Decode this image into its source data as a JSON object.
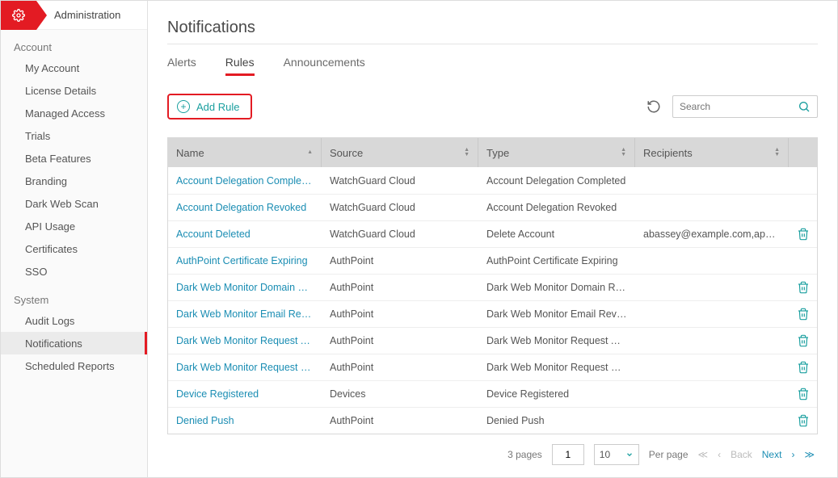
{
  "header": {
    "title": "Administration"
  },
  "sidebar": {
    "sections": [
      {
        "label": "Account",
        "items": [
          {
            "label": "My Account"
          },
          {
            "label": "License Details"
          },
          {
            "label": "Managed Access"
          },
          {
            "label": "Trials"
          },
          {
            "label": "Beta Features"
          },
          {
            "label": "Branding"
          },
          {
            "label": "Dark Web Scan"
          },
          {
            "label": "API Usage"
          },
          {
            "label": "Certificates"
          },
          {
            "label": "SSO"
          }
        ]
      },
      {
        "label": "System",
        "items": [
          {
            "label": "Audit Logs"
          },
          {
            "label": "Notifications",
            "active": true
          },
          {
            "label": "Scheduled Reports"
          }
        ]
      }
    ]
  },
  "page": {
    "title": "Notifications"
  },
  "tabs": [
    {
      "label": "Alerts"
    },
    {
      "label": "Rules",
      "active": true
    },
    {
      "label": "Announcements"
    }
  ],
  "toolbar": {
    "add_rule": "Add Rule",
    "search_placeholder": "Search"
  },
  "columns": {
    "name": "Name",
    "source": "Source",
    "type": "Type",
    "recipients": "Recipients"
  },
  "rows": [
    {
      "name": "Account Delegation Completed",
      "source": "WatchGuard Cloud",
      "type": "Account Delegation Completed",
      "recipients": "",
      "deletable": false
    },
    {
      "name": "Account Delegation Revoked",
      "source": "WatchGuard Cloud",
      "type": "Account Delegation Revoked",
      "recipients": "",
      "deletable": false
    },
    {
      "name": "Account Deleted",
      "source": "WatchGuard Cloud",
      "type": "Delete Account",
      "recipients": "abassey@example.com,apatel@e...",
      "deletable": true
    },
    {
      "name": "AuthPoint Certificate Expiring",
      "source": "AuthPoint",
      "type": "AuthPoint Certificate Expiring",
      "recipients": "",
      "deletable": false
    },
    {
      "name": "Dark Web Monitor Domain Revo...",
      "source": "AuthPoint",
      "type": "Dark Web Monitor Domain Revok...",
      "recipients": "",
      "deletable": true
    },
    {
      "name": "Dark Web Monitor Email Revoked",
      "source": "AuthPoint",
      "type": "Dark Web Monitor Email Revoked",
      "recipients": "",
      "deletable": true
    },
    {
      "name": "Dark Web Monitor Request Appr...",
      "source": "AuthPoint",
      "type": "Dark Web Monitor Request Appro...",
      "recipients": "",
      "deletable": true
    },
    {
      "name": "Dark Web Monitor Request Deni...",
      "source": "AuthPoint",
      "type": "Dark Web Monitor Request Denied",
      "recipients": "",
      "deletable": true
    },
    {
      "name": "Device Registered",
      "source": "Devices",
      "type": "Device Registered",
      "recipients": "",
      "deletable": true
    },
    {
      "name": "Denied Push",
      "source": "AuthPoint",
      "type": "Denied Push",
      "recipients": "",
      "deletable": true
    }
  ],
  "pager": {
    "pages_label": "3 pages",
    "current_page": "1",
    "per_page": "10",
    "per_page_label": "Per page",
    "back": "Back",
    "next": "Next"
  }
}
